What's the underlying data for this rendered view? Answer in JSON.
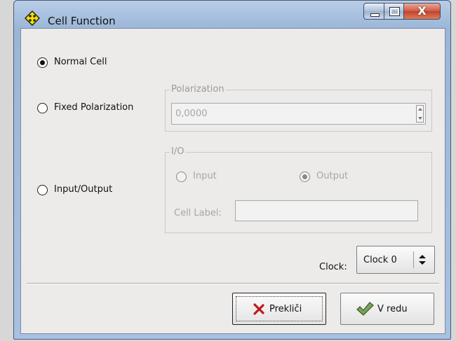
{
  "window": {
    "title": "Cell Function"
  },
  "mode": {
    "normal_label": "Normal Cell",
    "fixed_label": "Fixed Polarization",
    "io_label": "Input/Output",
    "selected": "normal"
  },
  "polarization": {
    "group_title": "Polarization",
    "value": "0,0000"
  },
  "io": {
    "group_title": "I/O",
    "input_label": "Input",
    "output_label": "Output",
    "selected": "output",
    "cell_label_caption": "Cell Label:",
    "cell_label_value": ""
  },
  "clock": {
    "caption": "Clock:",
    "value": "Clock 0"
  },
  "buttons": {
    "cancel_label": "Prekliči",
    "ok_label": "V redu"
  },
  "icons": [
    "app-icon",
    "minimize-icon",
    "maximize-icon",
    "close-icon",
    "cancel-x-icon",
    "ok-check-icon"
  ]
}
